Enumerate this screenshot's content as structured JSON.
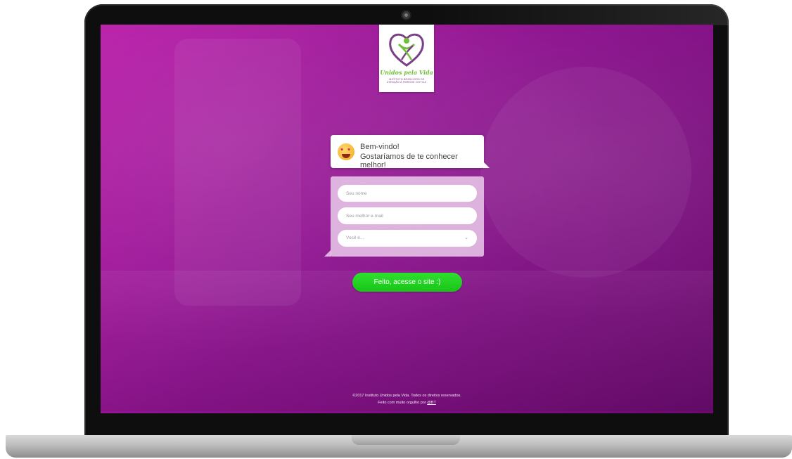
{
  "logo": {
    "name": "Unidos pela Vida",
    "subtitle": "INSTITUTO BRASILEIRO DE ATENÇÃO À FIBROSE CÍSTICA"
  },
  "welcome": {
    "line1": "Bem-vindo!",
    "line2": "Gostaríamos de te conhecer melhor!"
  },
  "form": {
    "name_placeholder": "Seu nome",
    "email_placeholder": "Seu melhor e-mail",
    "role_select_value": "Você é...",
    "submit_label": "Feito, acesse o site :)"
  },
  "footer": {
    "copyright": "©2017 Instituto Unidos pela Vida. Todos os direitos reservados.",
    "credit_prefix": "Feito com muito orgulho por",
    "credit_link": "@BT"
  },
  "colors": {
    "background": "#8e1490",
    "accent_green": "#18c418",
    "logo_green": "#6fbf3a",
    "logo_purple": "#7a3f86"
  }
}
